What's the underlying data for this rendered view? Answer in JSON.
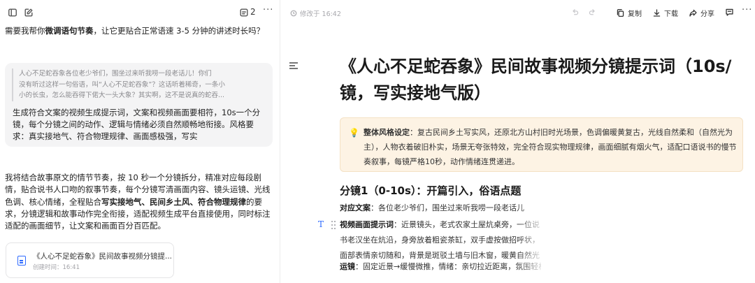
{
  "left": {
    "header": {
      "count": "2"
    },
    "question": {
      "prefix": "需要我帮你",
      "bold": "微调语句节奏",
      "suffix": "，让它更贴合正常语速 3-5 分钟的讲述时长吗？"
    },
    "user_message": {
      "quote_lines": [
        "人心不足蛇吞象各位老少爷们，围坐过来听我唠一段老话儿！你们",
        "没有听过这样一句俗语，叫“人心不足蛇吞象”？这话听着稀奇，一条小",
        "小的长虫，怎么能吞得下偌大一头大象？其实啊，这不是说真的蛇吞..."
      ],
      "text": "生成符合文案的视频生成提示词，文案和视频画面要相符，10s一个分镜，每个分镜之间的动作、逻辑与情绪必须自然顺畅地衔接。风格要求：真实接地气、符合物理规律、画面感极强，写实"
    },
    "response": {
      "part1": "我将结合故事原文的情节节奏，按 10 秒一个分镜拆分，精准对应每段剧情，贴合说书人口吻的叙事节奏，每个分镜写清画面内容、镜头运镜、光线色调、核心情绪，全程贴合",
      "bold": "写实接地气、民间乡土风、符合物理规律",
      "part2": "的要求，分镜逻辑和故事动作完全衔接，适配视频生成平台直接使用，同时标注适配的画面细节，让文案和画面百分百匹配。"
    },
    "file_card": {
      "title": "《人心不足蛇吞象》民间故事视频分镜提...",
      "subtitle": "创建时间：16:41"
    }
  },
  "right": {
    "toolbar": {
      "modified": "修改于 16:42",
      "copy": "复制",
      "download": "下载",
      "share": "分享"
    },
    "title": "《人心不足蛇吞象》民间故事视频分镜提示词（10s/镜，写实接地气版）",
    "callout": {
      "label": "整体风格设定",
      "text": "：复古民间乡土写实风，还原北方山村旧时光场景，色调偏暖黄复古，光线自然柔和（自然光为主），人物衣着破旧朴实，场景无夸张特效，完全符合现实物理规律，画面细腻有烟火气，适配口语说书的慢节奏叙事，每镜严格10秒，动作情绪连贯递进。"
    },
    "section1": {
      "heading": "分镜1（0-10s）：开篇引入，俗语点题",
      "rows": [
        {
          "label": "对应文案",
          "text": "：各位老少爷们，围坐过来听我唠一段老话儿"
        },
        {
          "label": "视频画面提示词",
          "text": "：近景镜头，老式农家土屋炕桌旁，一位说书老汉坐在炕沿，身旁放着粗瓷茶缸，双手虚按做招呼状，面部表情亲切随和，背景是斑驳土墙与旧木窗，暖黄自然光从窗外斜照，镜头缓慢推近，氛围闲适接地气，无多余特效，纯写实乡村场景"
        },
        {
          "label": "运镜",
          "text": "：固定近景→缓慢微推，情绪：亲切拉近距离，氛围轻松"
        }
      ]
    }
  }
}
